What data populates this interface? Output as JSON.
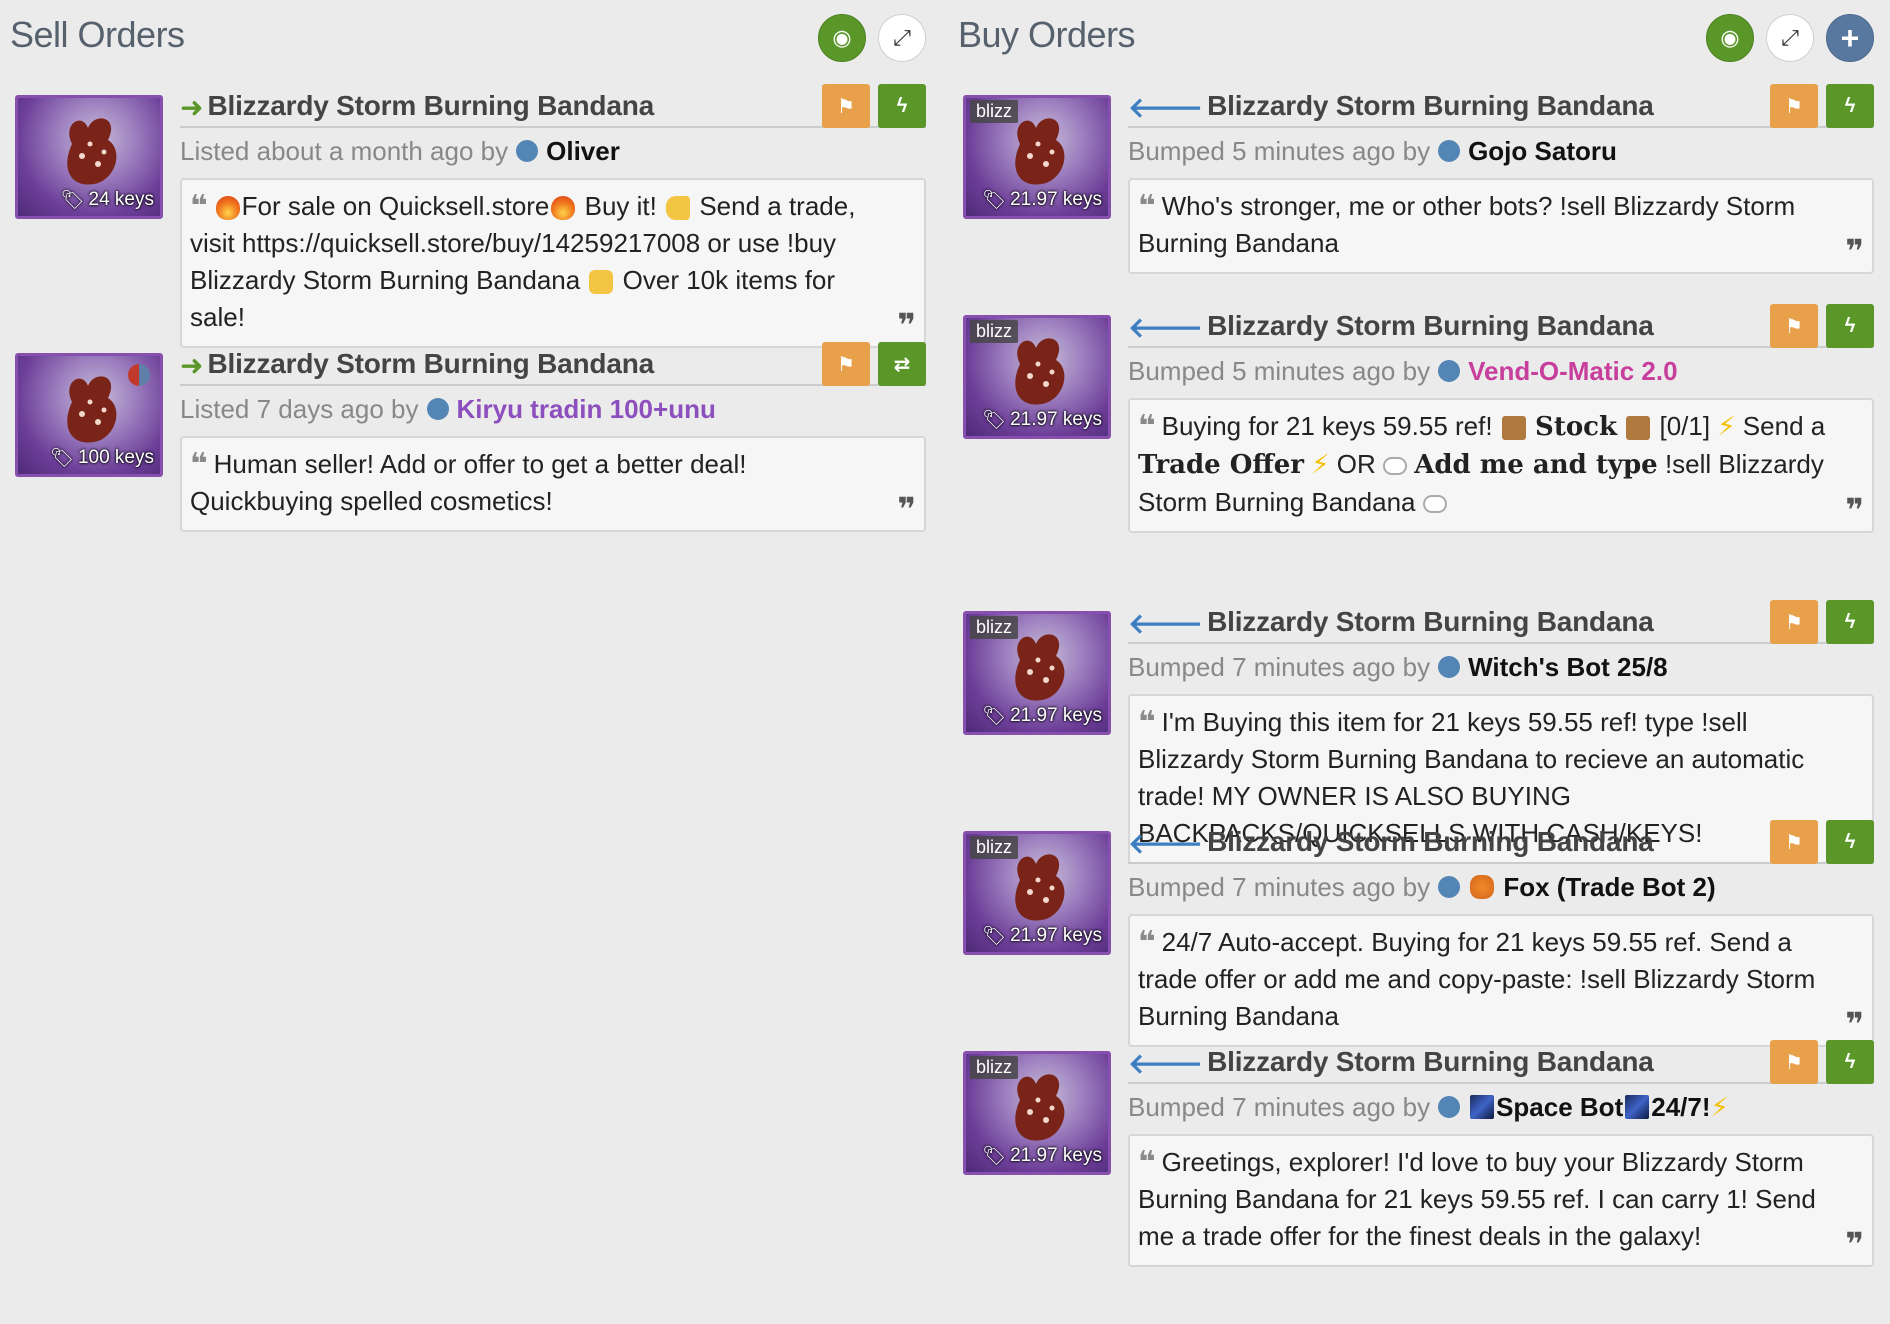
{
  "sell": {
    "title": "Sell Orders",
    "orders": [
      {
        "item": "Blizzardy Storm Burning Bandana",
        "price": "24 keys",
        "status": "Listed about a month ago by",
        "user": "Oliver",
        "note": {
          "t1": "For sale on Quicksell.store",
          "t2": " Buy it! ",
          "t3": " Send a trade, visit https://quicksell.store/buy/14259217008 or use !buy Blizzardy Storm Burning Bandana ",
          "t4": " Over 10k items for sale!"
        }
      },
      {
        "item": "Blizzardy Storm Burning Bandana",
        "price": "100 keys",
        "status": "Listed 7 days ago by",
        "user": "Kiryu tradin 100+unu",
        "note": {
          "t1": "Human seller! Add or offer to get a better deal! Quickbuying spelled cosmetics!"
        }
      }
    ]
  },
  "buy": {
    "title": "Buy Orders",
    "orders": [
      {
        "item": "Blizzardy Storm Burning Bandana",
        "effect": "blizz",
        "price": "21.97 keys",
        "status": "Bumped 5 minutes ago by",
        "user": "Gojo Satoru",
        "note": {
          "t1": "Who's stronger, me or other bots? !sell Blizzardy Storm Burning Bandana"
        }
      },
      {
        "item": "Blizzardy Storm Burning Bandana",
        "effect": "blizz",
        "price": "21.97 keys",
        "status": "Bumped 5 minutes ago by",
        "user": "Vend-O-Matic 2.0",
        "note": {
          "t1": "Buying for 21 keys 59.55 ref! ",
          "b1": "Stock",
          "t2": " [0/1] ",
          "t3": " Send a ",
          "b2": "Trade Offer",
          "t4": " OR ",
          "b3": "Add me and type",
          "t5": " !sell Blizzardy Storm Burning Bandana "
        }
      },
      {
        "item": "Blizzardy Storm Burning Bandana",
        "effect": "blizz",
        "price": "21.97 keys",
        "status": "Bumped 7 minutes ago by",
        "user": "Witch's Bot 25/8",
        "note": {
          "t1": "I'm Buying this item for 21 keys 59.55 ref! type !sell Blizzardy Storm Burning Bandana to recieve an automatic trade! MY OWNER IS ALSO BUYING BACKPACKS/QUICKSELLS WITH CASH/KEYS!"
        }
      },
      {
        "item": "Blizzardy Storm Burning Bandana",
        "effect": "blizz",
        "price": "21.97 keys",
        "status": "Bumped 7 minutes ago by",
        "user": "Fox (Trade Bot 2)",
        "note": {
          "t1": "24/7 Auto-accept. Buying for 21 keys 59.55 ref. Send a trade offer or add me and copy-paste: !sell Blizzardy Storm Burning Bandana"
        }
      },
      {
        "item": "Blizzardy Storm Burning Bandana",
        "effect": "blizz",
        "price": "21.97 keys",
        "status": "Bumped 7 minutes ago by",
        "user_a": "Space Bot",
        "user_b": " 24/7! ",
        "note": {
          "t1": "Greetings, explorer! I'd love to buy your Blizzardy Storm Burning Bandana for 21 keys 59.55 ref. I can carry 1! Send me a trade offer for the finest deals in the galaxy!"
        }
      }
    ]
  }
}
